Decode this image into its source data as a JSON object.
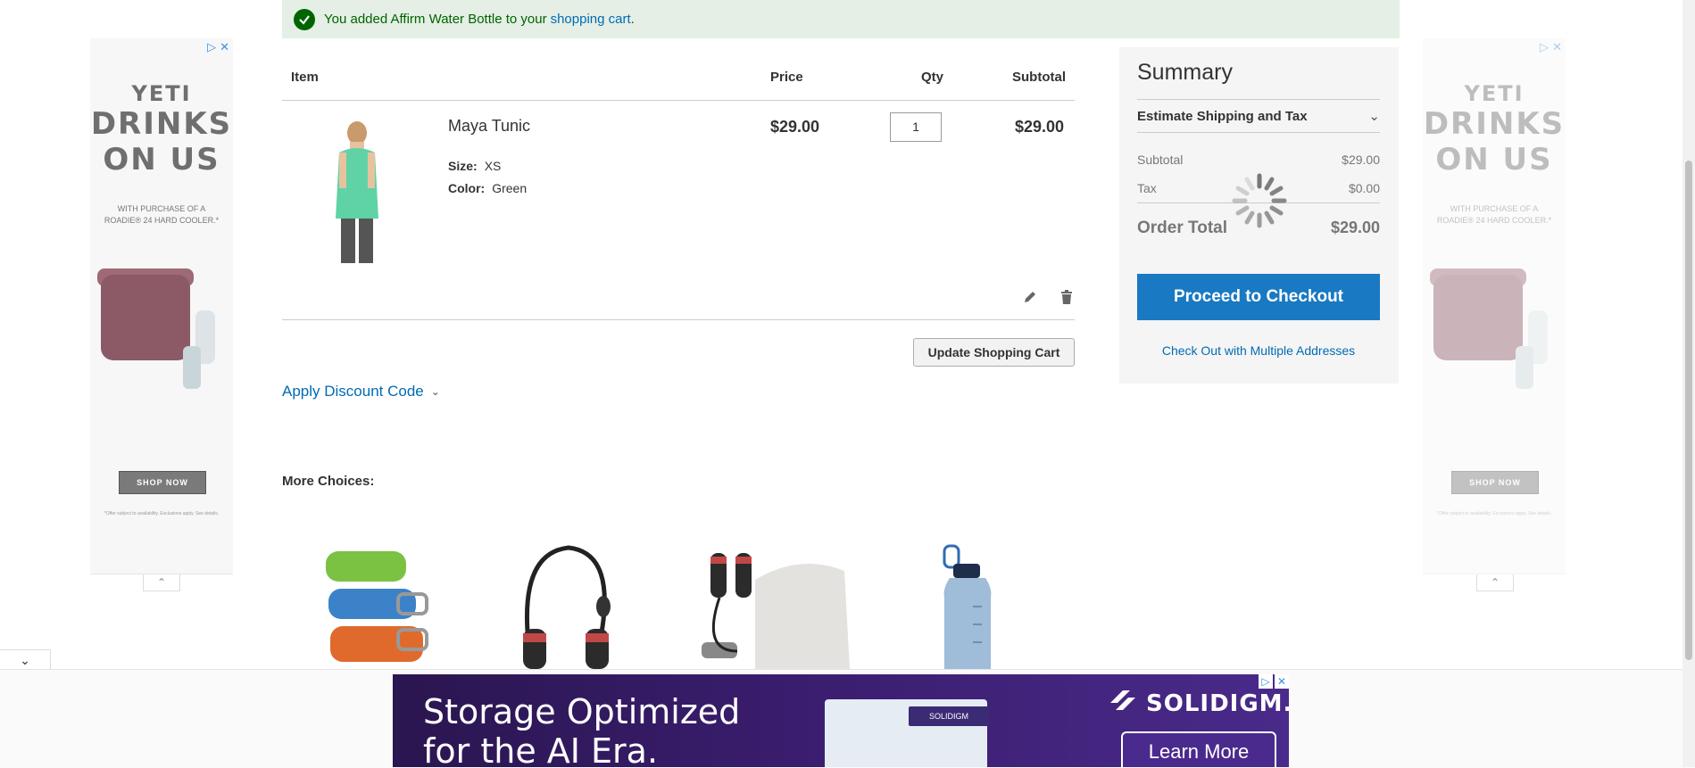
{
  "message": {
    "text": "You added Affirm Water Bottle to your",
    "link": "shopping cart",
    "suffix": "."
  },
  "side_ad": {
    "brand_line1": "YETI",
    "brand_line2": "DRINKS",
    "brand_line3": "ON US",
    "subtext": "WITH PURCHASE OF A ROADIE® 24 HARD COOLER.*",
    "cta": "SHOP NOW",
    "fine_print": "*Offer subject to availability. Exclusions apply. See details."
  },
  "cart": {
    "headers": {
      "item": "Item",
      "price": "Price",
      "qty": "Qty",
      "subtotal": "Subtotal"
    },
    "items": [
      {
        "name": "Maya Tunic",
        "options": [
          {
            "label": "Size:",
            "value": "XS"
          },
          {
            "label": "Color:",
            "value": "Green"
          }
        ],
        "price": "$29.00",
        "qty": "1",
        "subtotal": "$29.00"
      }
    ],
    "update_button": "Update Shopping Cart",
    "discount_label": "Apply Discount Code"
  },
  "summary": {
    "title": "Summary",
    "estimate_label": "Estimate Shipping and Tax",
    "rows": [
      {
        "label": "Subtotal",
        "value": "$29.00"
      },
      {
        "label": "Tax",
        "value": "$0.00"
      }
    ],
    "order_total_label": "Order Total",
    "order_total_value": "$29.00",
    "checkout_button": "Proceed to Checkout",
    "multi_address_link": "Check Out with Multiple Addresses"
  },
  "related": {
    "title": "More Choices:"
  },
  "bottom_ad": {
    "headline_line1": "Storage Optimized",
    "headline_line2": "for the AI Era.",
    "card_tag": "SOLIDIGM",
    "brand": "SOLIDIGM.",
    "cta": "Learn More"
  },
  "colors": {
    "accent": "#1979c3",
    "link": "#006bb4",
    "success_bg": "#e5efe5",
    "success_text": "#006400"
  }
}
